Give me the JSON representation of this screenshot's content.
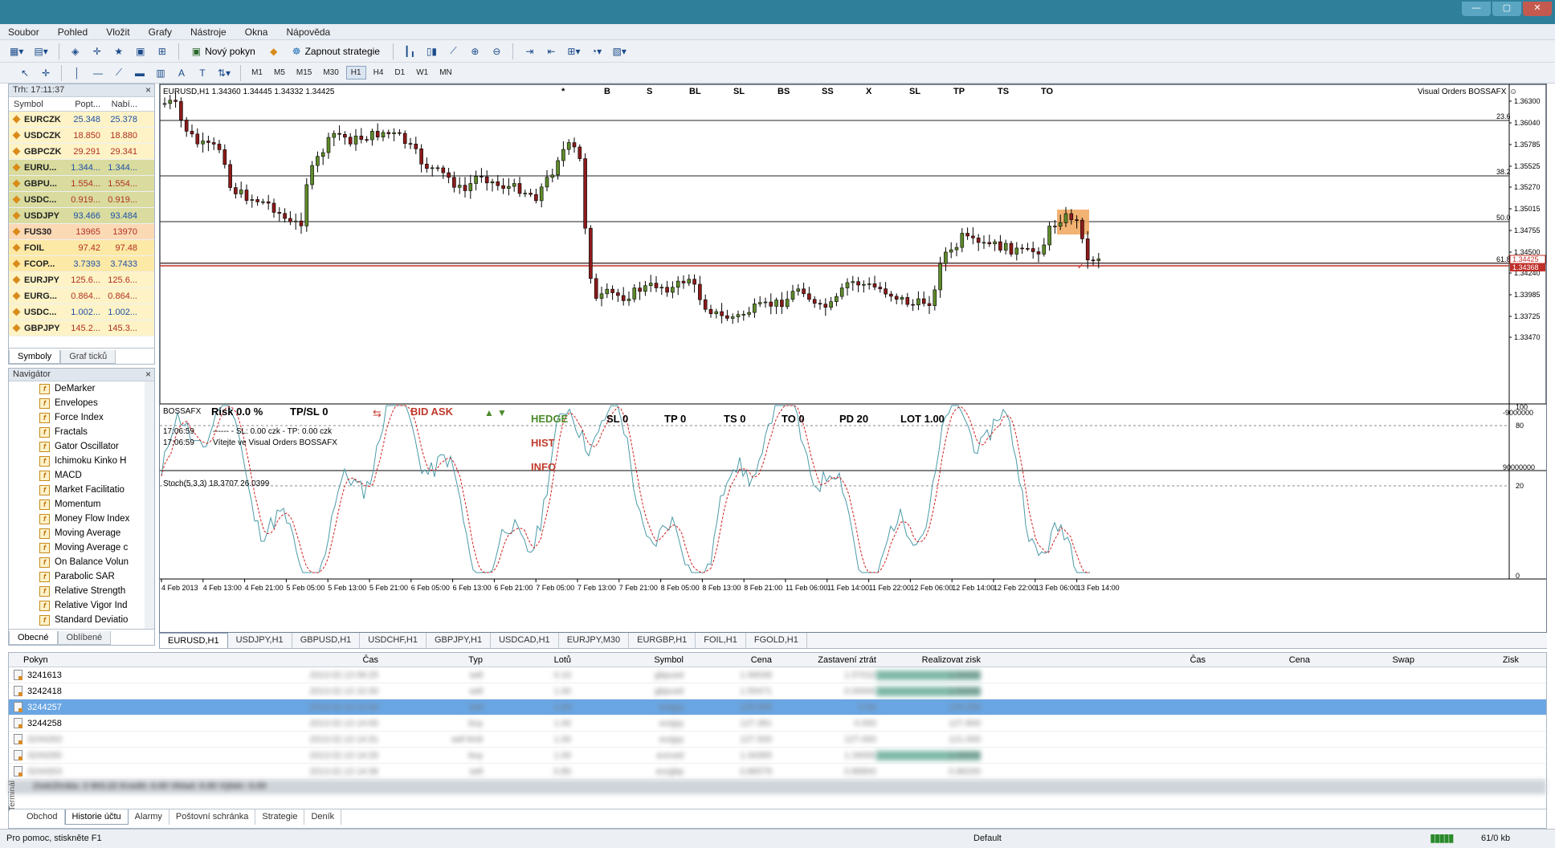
{
  "menu": {
    "items": [
      "Soubor",
      "Pohled",
      "Vložit",
      "Grafy",
      "Nástroje",
      "Okna",
      "Nápověda"
    ]
  },
  "toolbar": {
    "new_order": "Nový pokyn",
    "toggle_strategy": "Zapnout strategie"
  },
  "timeframes": [
    "M1",
    "M5",
    "M15",
    "M30",
    "H1",
    "H4",
    "D1",
    "W1",
    "MN"
  ],
  "market_watch": {
    "time": "Trh: 17:11:37",
    "headers": {
      "symbol": "Symbol",
      "bid": "Popt...",
      "ask": "Nabí..."
    },
    "rows": [
      {
        "symbol": "EURCZK",
        "bid": "25.348",
        "ask": "25.378"
      },
      {
        "symbol": "USDCZK",
        "bid": "18.850",
        "ask": "18.880"
      },
      {
        "symbol": "GBPCZK",
        "bid": "29.291",
        "ask": "29.341"
      },
      {
        "symbol": "EURU...",
        "bid": "1.344...",
        "ask": "1.344..."
      },
      {
        "symbol": "GBPU...",
        "bid": "1.554...",
        "ask": "1.554..."
      },
      {
        "symbol": "USDC...",
        "bid": "0.919...",
        "ask": "0.919..."
      },
      {
        "symbol": "USDJPY",
        "bid": "93.466",
        "ask": "93.484"
      },
      {
        "symbol": "FUS30",
        "bid": "13965",
        "ask": "13970"
      },
      {
        "symbol": "FOIL",
        "bid": "97.42",
        "ask": "97.48"
      },
      {
        "symbol": "FCOP...",
        "bid": "3.7393",
        "ask": "3.7433"
      },
      {
        "symbol": "EURJPY",
        "bid": "125.6...",
        "ask": "125.6..."
      },
      {
        "symbol": "EURG...",
        "bid": "0.864...",
        "ask": "0.864..."
      },
      {
        "symbol": "USDC...",
        "bid": "1.002...",
        "ask": "1.002..."
      },
      {
        "symbol": "GBPJPY",
        "bid": "145.2...",
        "ask": "145.3..."
      }
    ],
    "row_colors": [
      "#fdf3c6",
      "#fdf3c6",
      "#fdf3c6",
      "#d9dc9e",
      "#d9dc9e",
      "#d9dc9e",
      "#d9dc9e",
      "#fbd9b5",
      "#fde9a6",
      "#fde9a6",
      "#fdf3c6",
      "#fdf3c6",
      "#fdf3c6",
      "#fdf3c6"
    ],
    "tabs": [
      "Symboly",
      "Graf ticků"
    ]
  },
  "navigator": {
    "title": "Navigátor",
    "items": [
      "DeMarker",
      "Envelopes",
      "Force Index",
      "Fractals",
      "Gator Oscillator",
      "Ichimoku Kinko H",
      "MACD",
      "Market Facilitatio",
      "Momentum",
      "Money Flow Index",
      "Moving Average",
      "Moving Average c",
      "On Balance Volun",
      "Parabolic SAR",
      "Relative Strength",
      "Relative Vigor Ind",
      "Standard Deviatio"
    ],
    "tabs": [
      "Obecné",
      "Oblíbené"
    ]
  },
  "chart": {
    "header": "EURUSD,H1  1.34360 1.34445 1.34332 1.34425",
    "panel_buttons": [
      "*",
      "B",
      "S",
      "BL",
      "SL",
      "BS",
      "SS",
      "X",
      "SL",
      "TP",
      "TS",
      "TO"
    ],
    "brand": "Visual Orders BOSSAFX",
    "price_labels": [
      "1.36300",
      "1.36040",
      "1.35785",
      "1.35525",
      "1.35270",
      "1.35015",
      "1.34755",
      "1.34500",
      "1.34240",
      "1.33985",
      "1.33725",
      "1.33470"
    ],
    "fib_levels": [
      "23.6",
      "38.2",
      "50.0",
      "61.8"
    ],
    "current_bid": "1.34425",
    "current_ask": "1.34368",
    "orange_color": "#f0a45a"
  },
  "boss": {
    "label": "BOSSAFX",
    "risk": "Risk  0.0 %",
    "tpsl": "TP/SL  0",
    "bidask": "BID ASK",
    "hedge": "HEDGE",
    "hist": "HIST",
    "info": "INFO",
    "sl": "SL  0",
    "tp": "TP  0",
    "ts": "TS  0",
    "to": "TO  0",
    "pd": "PD  20",
    "lot": "LOT  1.00",
    "log1_time": "17:06:59",
    "log1_text": "------  - SL: 0.00 czk - TP: 0.00 czk",
    "log2_time": "17:06:59",
    "log2_text": "Vítejte ve Visual Orders BOSSAFX",
    "scale_top": "-9000000",
    "scale_bottom": "90000000"
  },
  "stoch": {
    "label": "Stoch(5,3,3) 18.3707 26.0399",
    "levels": [
      "100",
      "80",
      "20",
      "0"
    ]
  },
  "time_axis": [
    "4 Feb 2013",
    "4 Feb 13:00",
    "4 Feb 21:00",
    "5 Feb 05:00",
    "5 Feb 13:00",
    "5 Feb 21:00",
    "6 Feb 05:00",
    "6 Feb 13:00",
    "6 Feb 21:00",
    "7 Feb 05:00",
    "7 Feb 13:00",
    "7 Feb 21:00",
    "8 Feb 05:00",
    "8 Feb 13:00",
    "8 Feb 21:00",
    "11 Feb 06:00",
    "11 Feb 14:00",
    "11 Feb 22:00",
    "12 Feb 06:00",
    "12 Feb 14:00",
    "12 Feb 22:00",
    "13 Feb 06:00",
    "13 Feb 14:00"
  ],
  "chart_tabs": [
    "EURUSD,H1",
    "USDJPY,H1",
    "GBPUSD,H1",
    "USDCHF,H1",
    "GBPJPY,H1",
    "USDCAD,H1",
    "EURJPY,M30",
    "EURGBP,H1",
    "FOIL,H1",
    "FGOLD,H1"
  ],
  "terminal": {
    "headers": {
      "order": "Pokyn",
      "time": "Čas",
      "type": "Typ",
      "lots": "Lotů",
      "symbol": "Symbol",
      "price": "Cena",
      "sl": "Zastavení ztrát",
      "tp": "Realizovat zisk",
      "time2": "Čas",
      "price2": "Cena",
      "swap": "Swap",
      "profit": "Zisk"
    },
    "rows": [
      {
        "order": "3241613",
        "time": "2013.02.13 06:25",
        "type": "sell",
        "lots": "0.10",
        "symbol": "gbpusd",
        "price": "1.56539",
        "sl": "1.57010",
        "tp": "1.56450"
      },
      {
        "order": "3242418",
        "time": "2013.02.13 10:30",
        "type": "sell",
        "lots": "1.00",
        "symbol": "gbpusd",
        "price": "1.55471",
        "sl": "0.00000",
        "tp": "1.55950"
      },
      {
        "order": "3244257",
        "time": "2013.02.13 13:30",
        "type": "sell",
        "lots": "1.00",
        "symbol": "eurjpy",
        "price": "125.585",
        "sl": "0.00",
        "tp": "125.250"
      },
      {
        "order": "3244258",
        "time": "2013.02.13 14:00",
        "type": "buy",
        "lots": "1.00",
        "symbol": "eurjpy",
        "price": "127.381",
        "sl": "0.000",
        "tp": "127.800"
      },
      {
        "order": "3244263",
        "time": "2013.02.13 14:31",
        "type": "sell limit",
        "lots": "1.00",
        "symbol": "eurjpy",
        "price": "127.500",
        "sl": "127.000",
        "tp": "121.000"
      },
      {
        "order": "3244265",
        "time": "2013.02.13 14:33",
        "type": "buy",
        "lots": "1.00",
        "symbol": "eurusd",
        "price": "1.34365",
        "sl": "1.34000",
        "tp": "1.35000"
      },
      {
        "order": "3244303",
        "time": "2013.02.13 14:36",
        "type": "sell",
        "lots": "0.80",
        "symbol": "eurgbp",
        "price": "0.86579",
        "sl": "0.86800",
        "tp": "0.86200"
      }
    ],
    "total": "Zisk/Ztráta: 2 903.22  Kredit: 0.00  Vklad: 0.00  Výběr: 0.00",
    "tabs": [
      "Obchod",
      "Historie účtu",
      "Alarmy",
      "Poštovní schránka",
      "Strategie",
      "Deník"
    ],
    "label": "Terminál"
  },
  "status": {
    "help": "Pro pomoc, stiskněte F1",
    "profile": "Default",
    "traffic": "61/0 kb"
  }
}
